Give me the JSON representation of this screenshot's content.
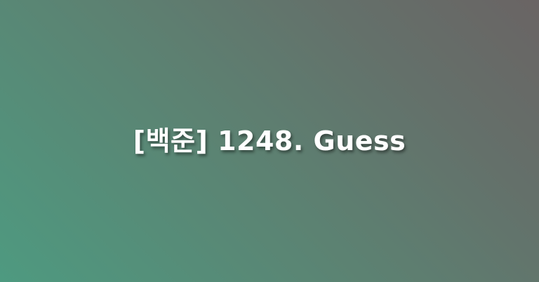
{
  "title": "[백준] 1248. Guess",
  "colors": {
    "gradient_start": "#4e9a80",
    "gradient_mid": "#5c8272",
    "gradient_end": "#6a6464",
    "text": "#ffffff"
  }
}
